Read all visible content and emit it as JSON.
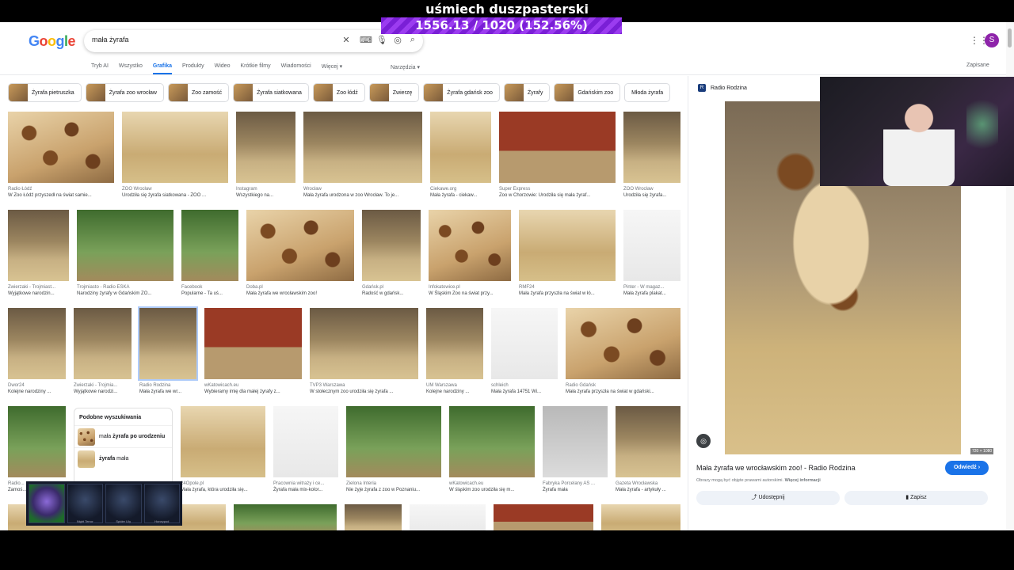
{
  "overlay": {
    "title": "uśmiech duszpasterski",
    "progress": "1556.13 / 1020 (152.56%)"
  },
  "header": {
    "logo": [
      "G",
      "o",
      "o",
      "g",
      "l",
      "e"
    ],
    "logo_colors": [
      "#4285F4",
      "#EA4335",
      "#FBBC05",
      "#4285F4",
      "#34A853",
      "#EA4335"
    ],
    "query": "mała żyrafa",
    "avatar": "S"
  },
  "tabs": [
    "Tryb AI",
    "Wszystko",
    "Grafika",
    "Produkty",
    "Wideo",
    "Krótkie filmy",
    "Wiadomości",
    "Więcej ▾"
  ],
  "tools": "Narzędzia ▾",
  "saved": "Zapisane",
  "chips": [
    "Żyrafa pietruszka",
    "Żyrafa zoo wrocław",
    "Zoo zamość",
    "Żyrafa siatkowana",
    "Zoo łódź",
    "Zwierzę",
    "Żyrafa gdańsk zoo",
    "Żyrafy",
    "Gdańskim zoo",
    "Młoda żyrafa"
  ],
  "results": [
    {
      "src": "Radio Łódź",
      "title": "W Zoo Łódź przyszedł na świat samie..."
    },
    {
      "src": "ZOO Wrocław",
      "title": "Urodziła się żyrafa siatkowana - ZOO ..."
    },
    {
      "src": "Instagram",
      "title": "Wszystkiego na..."
    },
    {
      "src": "Wrocław",
      "title": "Mała żyrafa urodzona w zoo Wrocław. To je..."
    },
    {
      "src": "Ciekawe.org",
      "title": "Mała żyrafa - ciekaw..."
    },
    {
      "src": "Super Express",
      "title": "Zoo w Chorzowie: Urodziła się mała żyraf..."
    },
    {
      "src": "ZOO Wrocław",
      "title": "Urodziła się żyrafa..."
    },
    {
      "src": "Zwierzaki - Trojmiast...",
      "title": "Wyjątkowe narodzin..."
    },
    {
      "src": "Trojmiasto - Radio ESKA",
      "title": "Narodziny żyrafy w Gdańskim ZO..."
    },
    {
      "src": "Facebook",
      "title": "Popularne - Ta uś..."
    },
    {
      "src": "Doba.pl",
      "title": "Mała żyrafa we wrocławskim zoo!"
    },
    {
      "src": "Gdańsk.pl",
      "title": "Radość w gdańsk..."
    },
    {
      "src": "Infokatowice.pl",
      "title": "W Śląskim Zoo na świat przy..."
    },
    {
      "src": "RMF24",
      "title": "Mała żyrafa przyszła na świat w łó..."
    },
    {
      "src": "Pinter - W magaz...",
      "title": "Mała żyrafa plakat..."
    },
    {
      "src": "Dwor24",
      "title": "Kolejne narodziny ..."
    },
    {
      "src": "Zwierzaki - Trojmia...",
      "title": "Wyjątkowe narodzi..."
    },
    {
      "src": "Radio Rodzina",
      "title": "Mała żyrafa we wr..."
    },
    {
      "src": "wKatowicach.eu",
      "title": "Wybieramy imię dla małej żyrafy z..."
    },
    {
      "src": "TVP3 Warszawa",
      "title": "W stołecznym zoo urodziła się żyrafa ..."
    },
    {
      "src": "UM Warszawa",
      "title": "Kolejne narodziny ..."
    },
    {
      "src": "schleich",
      "title": "Mała żyrafa 14751 Wi..."
    },
    {
      "src": "Radio Gdańsk",
      "title": "Mała żyrafa przyszła na świat w gdański..."
    },
    {
      "src": "Radio...",
      "title": "Zamoś..."
    },
    {
      "src": "24Opole.pl",
      "title": "Mała żyrafa, która urodziła się..."
    },
    {
      "src": "Pracownia witraży i ce...",
      "title": "Żyrafa mała mix-kolor..."
    },
    {
      "src": "Zielona Interia",
      "title": "Nie żyje żyrafa z zoo w Poznaniu..."
    },
    {
      "src": "wKatowicach.eu",
      "title": "W śląskim zoo urodziła się m..."
    },
    {
      "src": "Fabryka Porcelany AS ...",
      "title": "Żyrafa mała"
    },
    {
      "src": "Gazeta Wrocławska",
      "title": "Mała żyrafa - artykuły ..."
    }
  ],
  "similar": {
    "heading": "Podobne wyszukiwania",
    "items": [
      {
        "pre": "mała ",
        "bold": "żyrafa po urodzeniu"
      },
      {
        "pre": "",
        "bold": "żyrafa",
        "post": " mała"
      }
    ]
  },
  "panel": {
    "source": "Radio Rodzina",
    "dims": "720 × 1080",
    "title": "Mała żyrafa we wrocławskim zoo! - Radio Rodzina",
    "visit": "Odwiedź ›",
    "copyright": "Obrazy mogą być objęte prawami autorskimi.",
    "more_info": "Więcej informacji",
    "share": "Udostępnij",
    "save": "Zapisz"
  },
  "skins": [
    "",
    "Night Terror",
    "Spider Lily",
    "Honeypod"
  ]
}
